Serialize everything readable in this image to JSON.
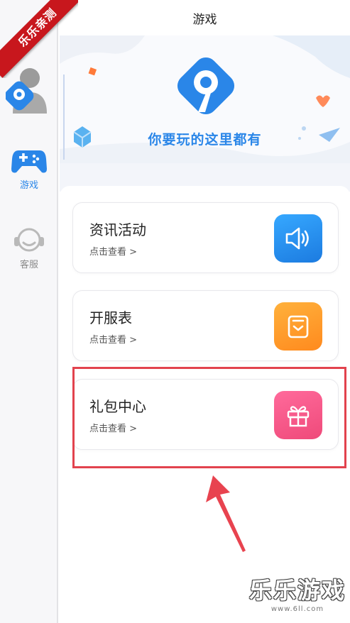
{
  "ribbon": {
    "text": "乐乐亲测"
  },
  "header": {
    "title": "游戏"
  },
  "sidebar": {
    "items": [
      {
        "label": "游戏",
        "icon": "gamepad-icon",
        "active": true,
        "color": "#2a86e8"
      },
      {
        "label": "客服",
        "icon": "headset-icon",
        "active": false,
        "color": "#8a8a8a"
      }
    ]
  },
  "banner": {
    "slogan": "你要玩的这里都有"
  },
  "cards": [
    {
      "title": "资讯活动",
      "subtitle": "点击查看 >",
      "icon": "speaker-icon",
      "color": "#2a8ef0"
    },
    {
      "title": "开服表",
      "subtitle": "点击查看 >",
      "icon": "clipboard-icon",
      "color": "#ff9a2a"
    },
    {
      "title": "礼包中心",
      "subtitle": "点击查看 >",
      "icon": "gift-icon",
      "color": "#f0558a"
    }
  ],
  "watermark": {
    "title": "乐乐游戏",
    "url": "www.6ll.com"
  },
  "colors": {
    "highlight": "#e2434e",
    "accent": "#2a86e8"
  }
}
